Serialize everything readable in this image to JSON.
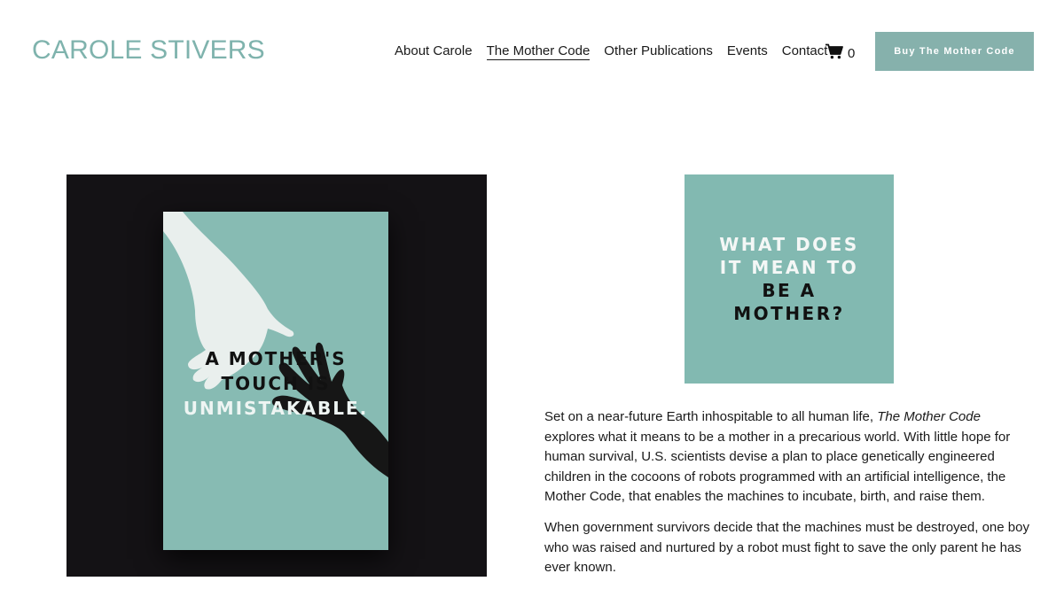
{
  "header": {
    "site_title": "CAROLE STIVERS",
    "nav": [
      {
        "label": "About Carole",
        "active": false
      },
      {
        "label": "The Mother Code",
        "active": true
      },
      {
        "label": "Other Publications",
        "active": false
      },
      {
        "label": "Events",
        "active": false
      },
      {
        "label": "Contact",
        "active": false
      }
    ],
    "cart_count": "0",
    "cart_icon": "cart-icon",
    "cta_label": "Buy The Mother Code"
  },
  "book_cover": {
    "line1": "A MOTHER'S",
    "line2": "TOUCH IS",
    "line3": "UNMISTAKABLE."
  },
  "quote_tile": {
    "line1": "WHAT DOES",
    "line2": "IT MEAN TO",
    "line3": "BE A",
    "line4": "MOTHER?"
  },
  "description": {
    "p1_before": "Set on a near-future Earth inhospitable to all human life, ",
    "p1_title": "The Mother Code",
    "p1_after": " explores what it means to be a mother in a precarious world. With little hope  for human survival, U.S. scientists devise a plan to place genetically  engineered children in the cocoons of robots programmed with an  artificial intelligence, the Mother Code, that enables the machines to incubate, birth, and raise them.",
    "p2": "When government survivors decide that the machines must be destroyed,  one boy who was raised and nurtured by a robot must fight to save the  only parent he has ever known."
  },
  "colors": {
    "brand_teal": "#7fb3ad",
    "cta_bg": "#86b1ac",
    "cover_teal": "#87bbb3",
    "tile_teal": "#82b9b1",
    "panel_dark": "#141215"
  }
}
